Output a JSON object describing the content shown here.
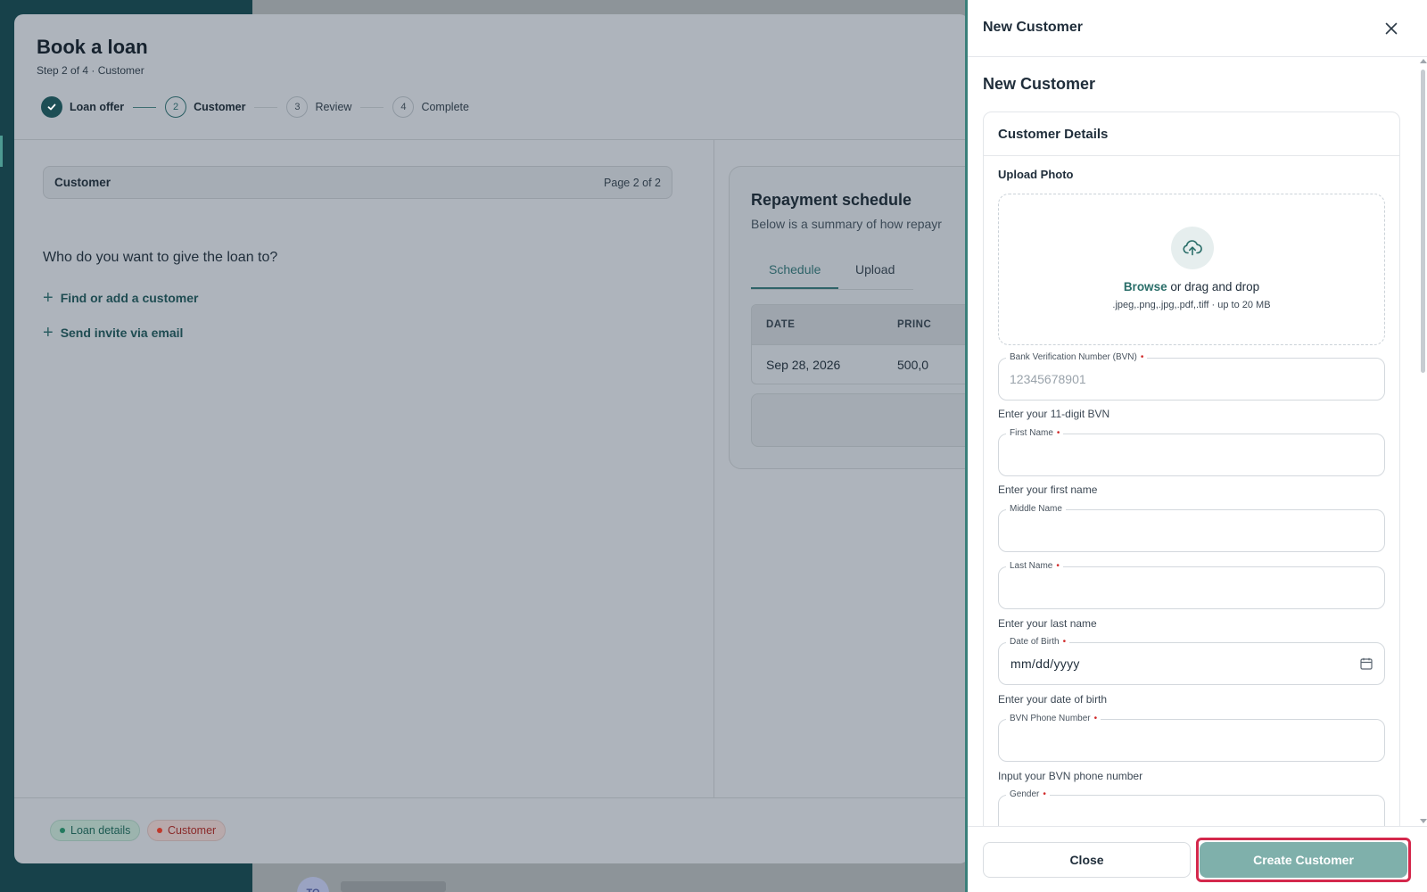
{
  "background": {
    "avatar_initials": "TO"
  },
  "loan_modal": {
    "title": "Book a loan",
    "subtitle": "Step 2 of 4 · Customer",
    "steps": [
      {
        "number": "",
        "label": "Loan offer",
        "state": "done"
      },
      {
        "number": "2",
        "label": "Customer",
        "state": "current"
      },
      {
        "number": "3",
        "label": "Review",
        "state": "todo"
      },
      {
        "number": "4",
        "label": "Complete",
        "state": "todo"
      }
    ],
    "customer_section": {
      "title": "Customer",
      "page_indicator": "Page 2 of 2"
    },
    "question": "Who do you want to give the loan to?",
    "find_customer_label": "Find or add a customer",
    "send_invite_label": "Send invite via email",
    "repayment": {
      "title": "Repayment schedule",
      "subtitle": "Below is a summary of how repayr",
      "tabs": [
        "Schedule",
        "Upload"
      ],
      "active_tab": "Schedule",
      "columns": [
        "DATE",
        "PRINC"
      ],
      "rows": [
        [
          "Sep 28, 2026",
          "500,0"
        ]
      ]
    },
    "status_badges": [
      {
        "label": "Loan details",
        "status": "complete",
        "color": "#247a5f"
      },
      {
        "label": "Customer",
        "status": "incomplete",
        "color": "#c0392b"
      }
    ]
  },
  "drawer": {
    "header_title": "New Customer",
    "heading": "New Customer",
    "card_title": "Customer Details",
    "upload": {
      "label": "Upload Photo",
      "browse_label": "Browse",
      "drop_text": " or drag and drop",
      "hint": ".jpeg,.png,.jpg,.pdf,.tiff · up to 20 MB"
    },
    "fields": {
      "bvn": {
        "label": "Bank Verification Number (BVN)",
        "required": "•",
        "value": "",
        "placeholder": "12345678901",
        "helper": "Enter your 11-digit BVN"
      },
      "first_name": {
        "label": "First Name",
        "required": "•",
        "value": "",
        "placeholder": "",
        "helper": "Enter your first name"
      },
      "middle_name": {
        "label": "Middle Name",
        "value": "",
        "placeholder": ""
      },
      "last_name": {
        "label": "Last Name",
        "required": "•",
        "value": "",
        "placeholder": "",
        "helper": "Enter your last name"
      },
      "dob": {
        "label": "Date of Birth",
        "required": "•",
        "value": "mm/dd/yyyy",
        "helper": "Enter your date of birth"
      },
      "bvn_phone": {
        "label": "BVN Phone Number",
        "required": "•",
        "value": "",
        "placeholder": "",
        "helper": "Input your BVN phone number"
      },
      "gender": {
        "label": "Gender",
        "required": "•",
        "value": ""
      }
    },
    "footer": {
      "close_label": "Close",
      "create_label": "Create Customer"
    }
  },
  "colors": {
    "brand_teal": "#2a6e69",
    "create_button": "#7fb0ab",
    "highlight_ring": "#d4284c",
    "required_marker": "#d12a2a"
  }
}
